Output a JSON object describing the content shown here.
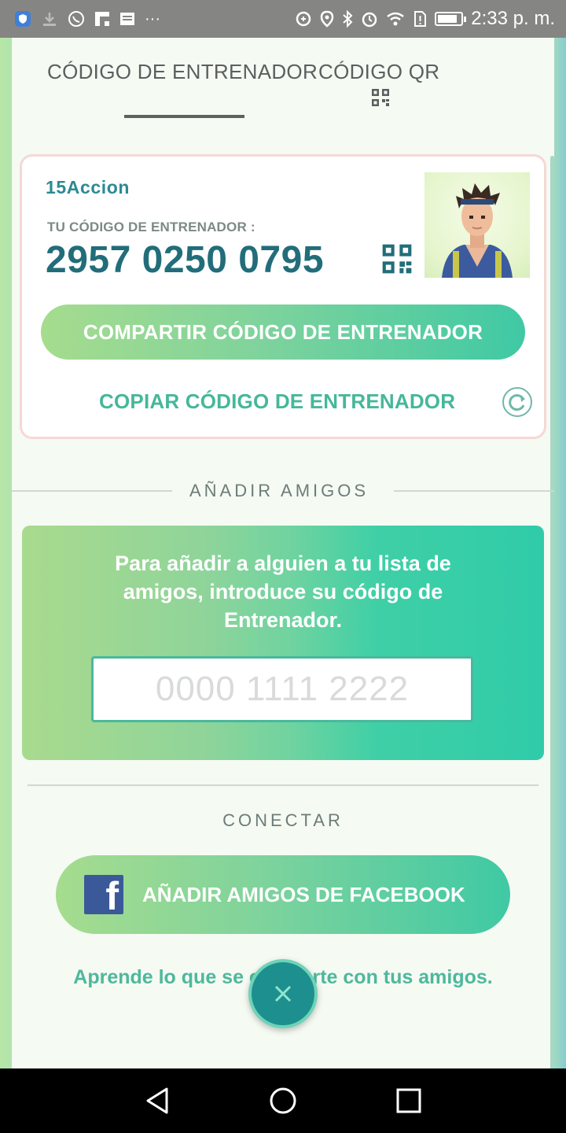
{
  "status_bar": {
    "time": "2:33 p. m.",
    "left_icons": [
      "shield-icon",
      "download-icon",
      "whatsapp-icon",
      "flipboard-icon",
      "news-icon",
      "more-dots-icon"
    ],
    "right_icons": [
      "data-saver-icon",
      "location-icon",
      "bluetooth-icon",
      "alarm-icon",
      "wifi-icon",
      "sim-alert-icon",
      "battery-icon"
    ],
    "more_glyph": "···"
  },
  "tabs": {
    "trainer_code": "CÓDIGO DE ENTRENADOR",
    "qr_code": "CÓDIGO QR",
    "active": "trainer_code"
  },
  "card": {
    "username": "15Accion",
    "code_label": "TU CÓDIGO DE ENTRENADOR :",
    "code_value": "2957 0250 0795",
    "share_button": "COMPARTIR CÓDIGO DE ENTRENADOR",
    "copy_button": "COPIAR CÓDIGO DE ENTRENADOR"
  },
  "add_friends": {
    "section_title": "AÑADIR AMIGOS",
    "instructions": "Para añadir a alguien a tu lista de amigos, introduce su código de Entrenador.",
    "input_placeholder": "0000 1111 2222",
    "input_value": ""
  },
  "connect": {
    "section_title": "CONECTAR",
    "facebook_button": "AÑADIR AMIGOS DE FACEBOOK",
    "learn_link": "Aprende lo que se comparte con tus amigos."
  },
  "colors": {
    "accent_green": "#46b79a",
    "code_teal": "#226d7a",
    "facebook_blue": "#3b5998",
    "close_button": "#1e8f8f"
  }
}
